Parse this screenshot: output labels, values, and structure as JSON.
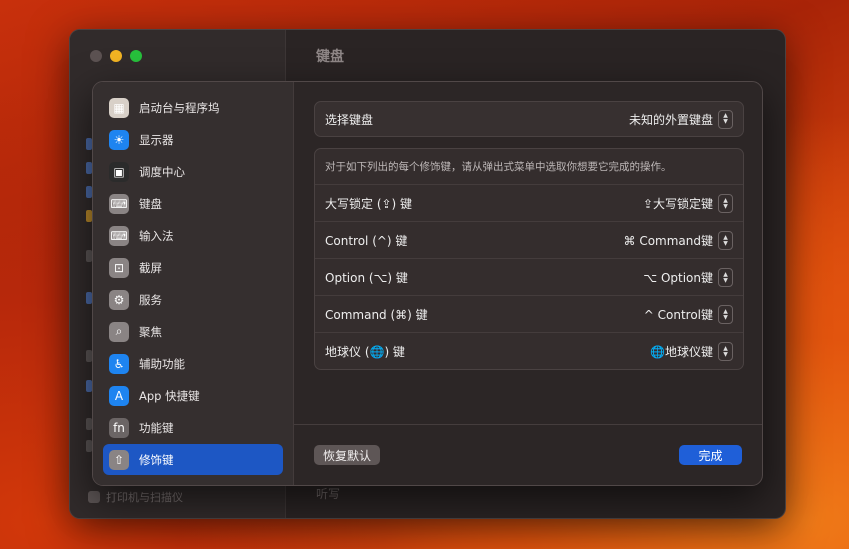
{
  "background_window": {
    "title": "键盘",
    "printer_item": "打印机与扫描仪",
    "dictation_label": "听写"
  },
  "sidebar": {
    "items": [
      {
        "label": "启动台与程序坞",
        "icon": "launchpad-icon",
        "glyph": "▦",
        "color": "#d8d0c8"
      },
      {
        "label": "显示器",
        "icon": "display-icon",
        "glyph": "☀",
        "color": "#1e84f0"
      },
      {
        "label": "调度中心",
        "icon": "mission-control-icon",
        "glyph": "▣",
        "color": "#2b2b2b"
      },
      {
        "label": "键盘",
        "icon": "keyboard-icon",
        "glyph": "⌨",
        "color": "#8a8484"
      },
      {
        "label": "输入法",
        "icon": "input-method-icon",
        "glyph": "⌨",
        "color": "#8a8484"
      },
      {
        "label": "截屏",
        "icon": "screenshot-icon",
        "glyph": "⊡",
        "color": "#8a8484"
      },
      {
        "label": "服务",
        "icon": "services-icon",
        "glyph": "⚙",
        "color": "#8a8484"
      },
      {
        "label": "聚焦",
        "icon": "spotlight-icon",
        "glyph": "⌕",
        "color": "#8a8484"
      },
      {
        "label": "辅助功能",
        "icon": "accessibility-icon",
        "glyph": "♿",
        "color": "#1e84f0"
      },
      {
        "label": "App 快捷键",
        "icon": "app-shortcuts-icon",
        "glyph": "A",
        "color": "#1e84f0"
      },
      {
        "label": "功能键",
        "icon": "function-key-icon",
        "glyph": "fn",
        "color": "#6b6565"
      },
      {
        "label": "修饰键",
        "icon": "modifier-key-icon",
        "glyph": "⇧",
        "color": "#8a8484"
      }
    ],
    "active_index": 11
  },
  "keyboard_select": {
    "label": "选择键盘",
    "value": "未知的外置键盘"
  },
  "modifiers": {
    "description": "对于如下列出的每个修饰键，请从弹出式菜单中选取你想要它完成的操作。",
    "rows": [
      {
        "label": "大写锁定 (⇪) 键",
        "value": "⇪大写锁定键"
      },
      {
        "label": "Control (^) 键",
        "value": "⌘ Command键"
      },
      {
        "label": "Option (⌥) 键",
        "value": "⌥ Option键"
      },
      {
        "label": "Command (⌘) 键",
        "value": "^ Control键"
      },
      {
        "label": "地球仪 (🌐) 键",
        "value": "🌐地球仪键"
      }
    ]
  },
  "buttons": {
    "reset": "恢复默认",
    "done": "完成"
  },
  "stepper_glyphs": {
    "up": "▲",
    "down": "▼"
  },
  "colors": {
    "accent": "#1d57c4",
    "done_button": "#1f5fd8"
  }
}
